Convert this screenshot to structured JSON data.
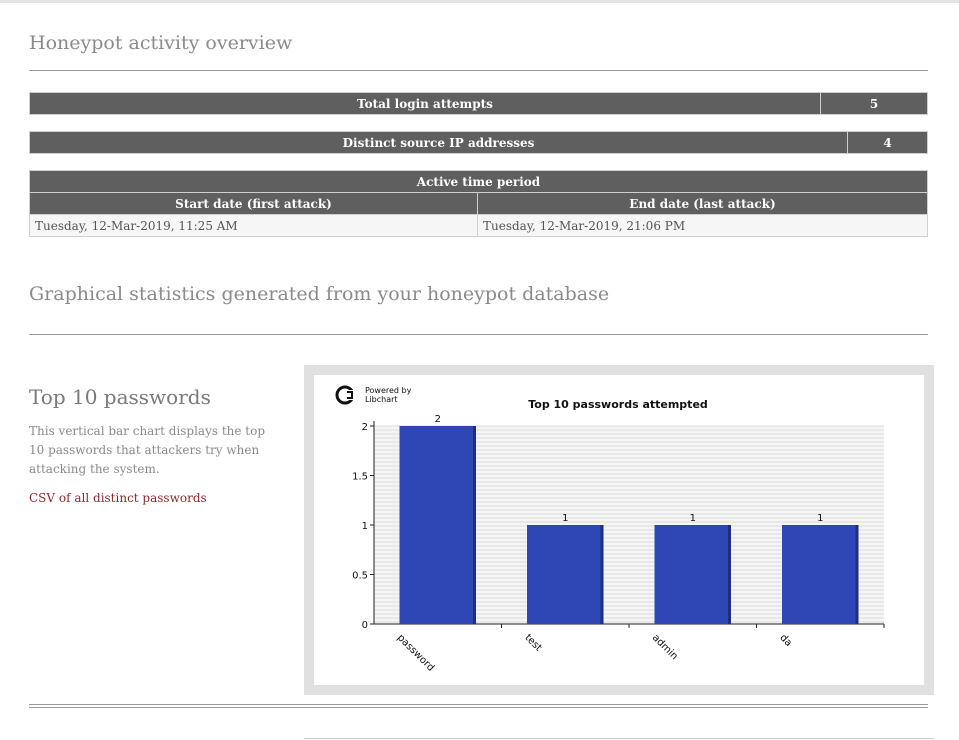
{
  "page": {
    "title": "Honeypot activity overview",
    "graph_title": "Graphical statistics generated from your honeypot database"
  },
  "stats": {
    "total_label": "Total login attempts",
    "total_value": "5",
    "distinct_label": "Distinct source IP addresses",
    "distinct_value": "4",
    "period_label": "Active time period",
    "start_label": "Start date (first attack)",
    "end_label": "End date (last attack)",
    "start_value": "Tuesday, 12-Mar-2019, 11:25 AM",
    "end_value": "Tuesday, 12-Mar-2019, 21:06 PM"
  },
  "section": {
    "title": "Top 10 passwords",
    "description": "This vertical bar chart displays the top 10 passwords that attackers try when attacking the system.",
    "csv_link": "CSV of all distinct passwords"
  },
  "chart_logo": {
    "line1": "Powered by",
    "line2": "Libchart"
  },
  "colors": {
    "bar": "#2f47b5",
    "bar_shade": "#1f2f80",
    "header_bg": "#5f5f5f",
    "link": "#8b2a2a"
  },
  "chart_data": {
    "type": "bar",
    "title": "Top 10 passwords attempted",
    "categories": [
      "password",
      "test",
      "admin",
      "da"
    ],
    "values": [
      2,
      1,
      1,
      1
    ],
    "data_labels": [
      "2",
      "1",
      "1",
      "1"
    ],
    "ylim": [
      0,
      2
    ],
    "yticks": [
      "0",
      "0.5",
      "1",
      "1.5",
      "2"
    ],
    "xlabel": "",
    "ylabel": "",
    "grid": true
  }
}
